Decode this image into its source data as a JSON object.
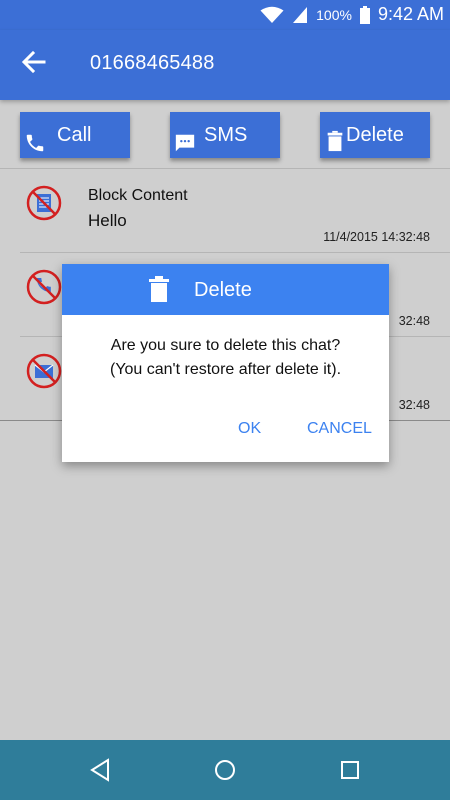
{
  "status_bar": {
    "battery": "100%",
    "time": "9:42 AM",
    "icons": [
      "wifi-icon",
      "signal-icon",
      "battery-icon"
    ]
  },
  "app_bar": {
    "title": "01668465488",
    "back_icon": "arrow-left-icon"
  },
  "actions": {
    "call_label": "Call",
    "sms_label": "SMS",
    "delete_label": "Delete"
  },
  "list": {
    "items": [
      {
        "icon": "blocked-message-icon",
        "title": "Block Content",
        "message": "Hello",
        "timestamp": "11/4/2015 14:32:48"
      },
      {
        "icon": "blocked-call-icon",
        "title": "",
        "message": "",
        "timestamp": "32:48"
      },
      {
        "icon": "blocked-sms-icon",
        "title": "",
        "message": "",
        "timestamp": "32:48"
      }
    ]
  },
  "dialog": {
    "title": "Delete",
    "message_line1": "Are you sure to delete this chat?",
    "message_line2": "(You can't restore after delete it).",
    "ok_label": "OK",
    "cancel_label": "CANCEL"
  },
  "colors": {
    "primary": "#3c6fd6",
    "dialog_header": "#3c82f0",
    "nav_bar": "#2f7d9a",
    "block_red": "#d32020"
  }
}
